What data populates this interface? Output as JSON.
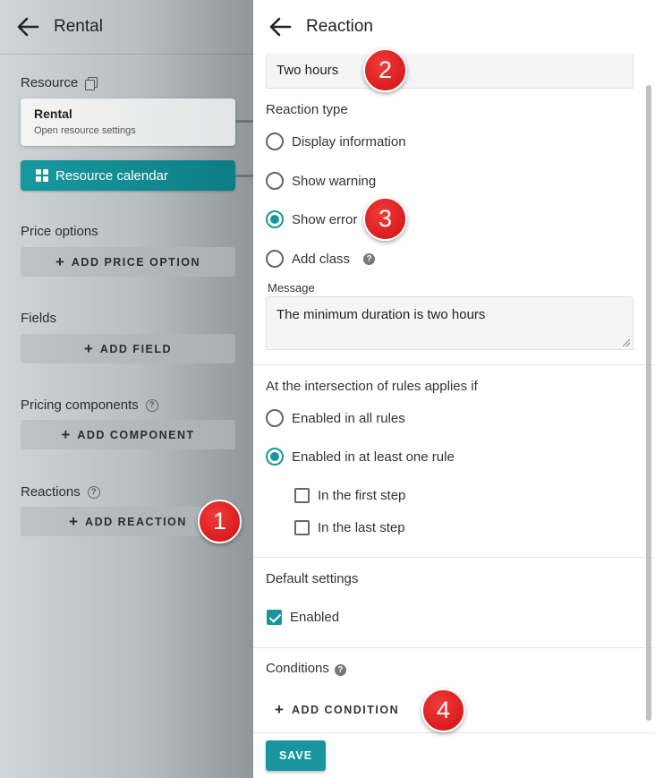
{
  "left_panel": {
    "title": "Rental",
    "resource_label": "Resource",
    "resource_card": {
      "title": "Rental",
      "subtitle": "Open resource settings"
    },
    "calendar_button": "Resource calendar",
    "price_options_label": "Price options",
    "add_price_option": "ADD PRICE OPTION",
    "fields_label": "Fields",
    "add_field": "ADD FIELD",
    "pricing_components_label": "Pricing components",
    "add_component": "ADD COMPONENT",
    "reactions_label": "Reactions",
    "add_reaction": "ADD REACTION"
  },
  "right_panel": {
    "title": "Reaction",
    "name_value": "Two hours",
    "reaction_type_label": "Reaction type",
    "reaction_types": [
      {
        "label": "Display information",
        "selected": false
      },
      {
        "label": "Show warning",
        "selected": false
      },
      {
        "label": "Show error",
        "selected": true
      },
      {
        "label": "Add class",
        "selected": false
      }
    ],
    "message_label": "Message",
    "message_value": "The minimum duration is two hours",
    "intersection_label": "At the intersection of rules applies if",
    "intersection_options": [
      {
        "label": "Enabled in all rules",
        "selected": false
      },
      {
        "label": "Enabled in at least one rule",
        "selected": true
      }
    ],
    "step_checks": [
      {
        "label": "In the first step",
        "checked": false
      },
      {
        "label": "In the last step",
        "checked": false
      }
    ],
    "default_settings_label": "Default settings",
    "enabled_label": "Enabled",
    "enabled_checked": true,
    "conditions_label": "Conditions",
    "add_condition": "ADD CONDITION",
    "save": "SAVE"
  },
  "markers": [
    "1",
    "2",
    "3",
    "4"
  ],
  "colors": {
    "accent": "#17979d",
    "marker": "#d81d1d"
  }
}
